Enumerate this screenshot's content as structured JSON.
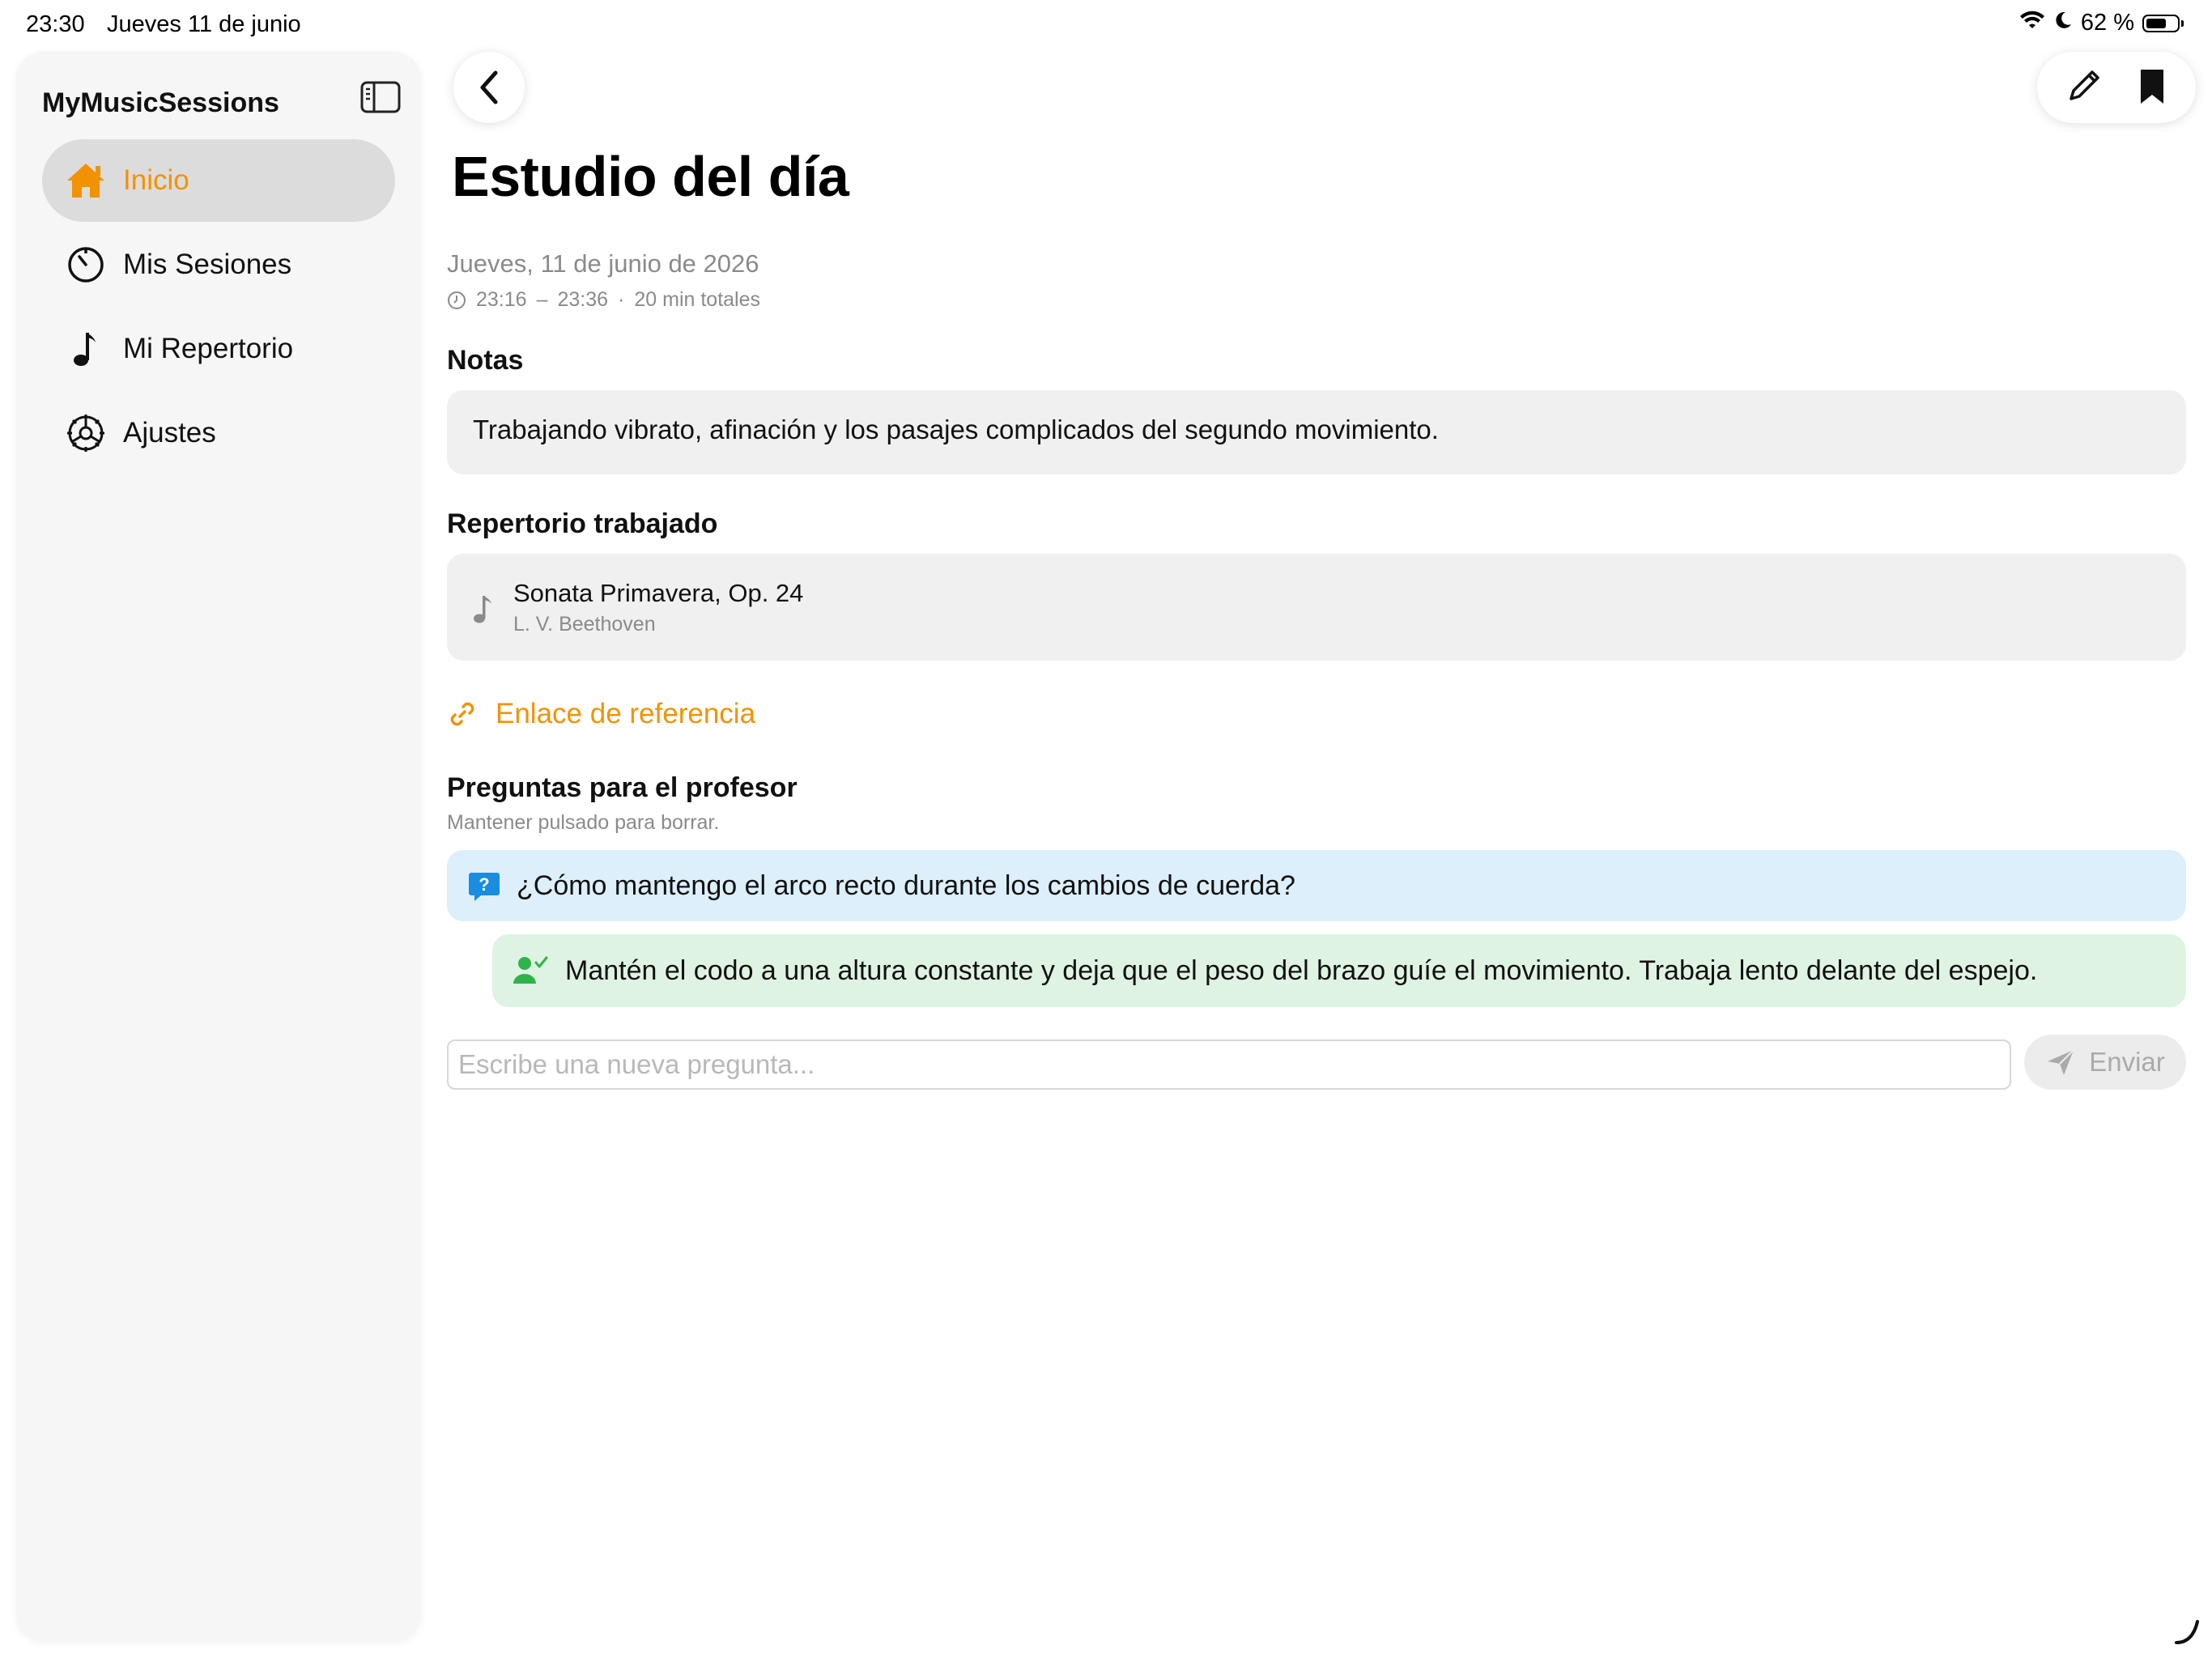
{
  "status_bar": {
    "time": "23:30",
    "date": "Jueves 11 de junio",
    "battery": "62 %"
  },
  "sidebar": {
    "app_title": "MyMusicSessions",
    "items": [
      {
        "label": "Inicio",
        "icon": "house-icon",
        "active": true
      },
      {
        "label": "Mis Sesiones",
        "icon": "timer-icon",
        "active": false
      },
      {
        "label": "Mi Repertorio",
        "icon": "music-note-icon",
        "active": false
      },
      {
        "label": "Ajustes",
        "icon": "gear-icon",
        "active": false
      }
    ]
  },
  "header": {
    "title": "Estudio del día"
  },
  "session": {
    "date": "Jueves, 11 de junio de 2026",
    "start": "23:16",
    "dash": "–",
    "end": "23:36",
    "dot": "·",
    "total": "20 min totales"
  },
  "notes": {
    "heading": "Notas",
    "text": "Trabajando vibrato, afinación y los pasajes complicados del segundo movimiento."
  },
  "repertoire": {
    "heading": "Repertorio trabajado",
    "piece_title": "Sonata Primavera, Op. 24",
    "composer": "L. V. Beethoven"
  },
  "reference_link": {
    "label": "Enlace de referencia"
  },
  "questions": {
    "heading": "Preguntas para el profesor",
    "hint": "Mantener pulsado para borrar.",
    "question": "¿Cómo mantengo el arco recto durante los cambios de cuerda?",
    "answer": "Mantén el codo a una altura constante y deja que el peso del brazo guíe el movimiento. Trabaja lento delante del espejo.",
    "input_placeholder": "Escribe una nueva pregunta...",
    "send_label": "Enviar"
  },
  "colors": {
    "accent": "#f39200",
    "question_bg": "#dceffb",
    "answer_bg": "#dff3e3",
    "card_bg": "#f0f0f0"
  }
}
